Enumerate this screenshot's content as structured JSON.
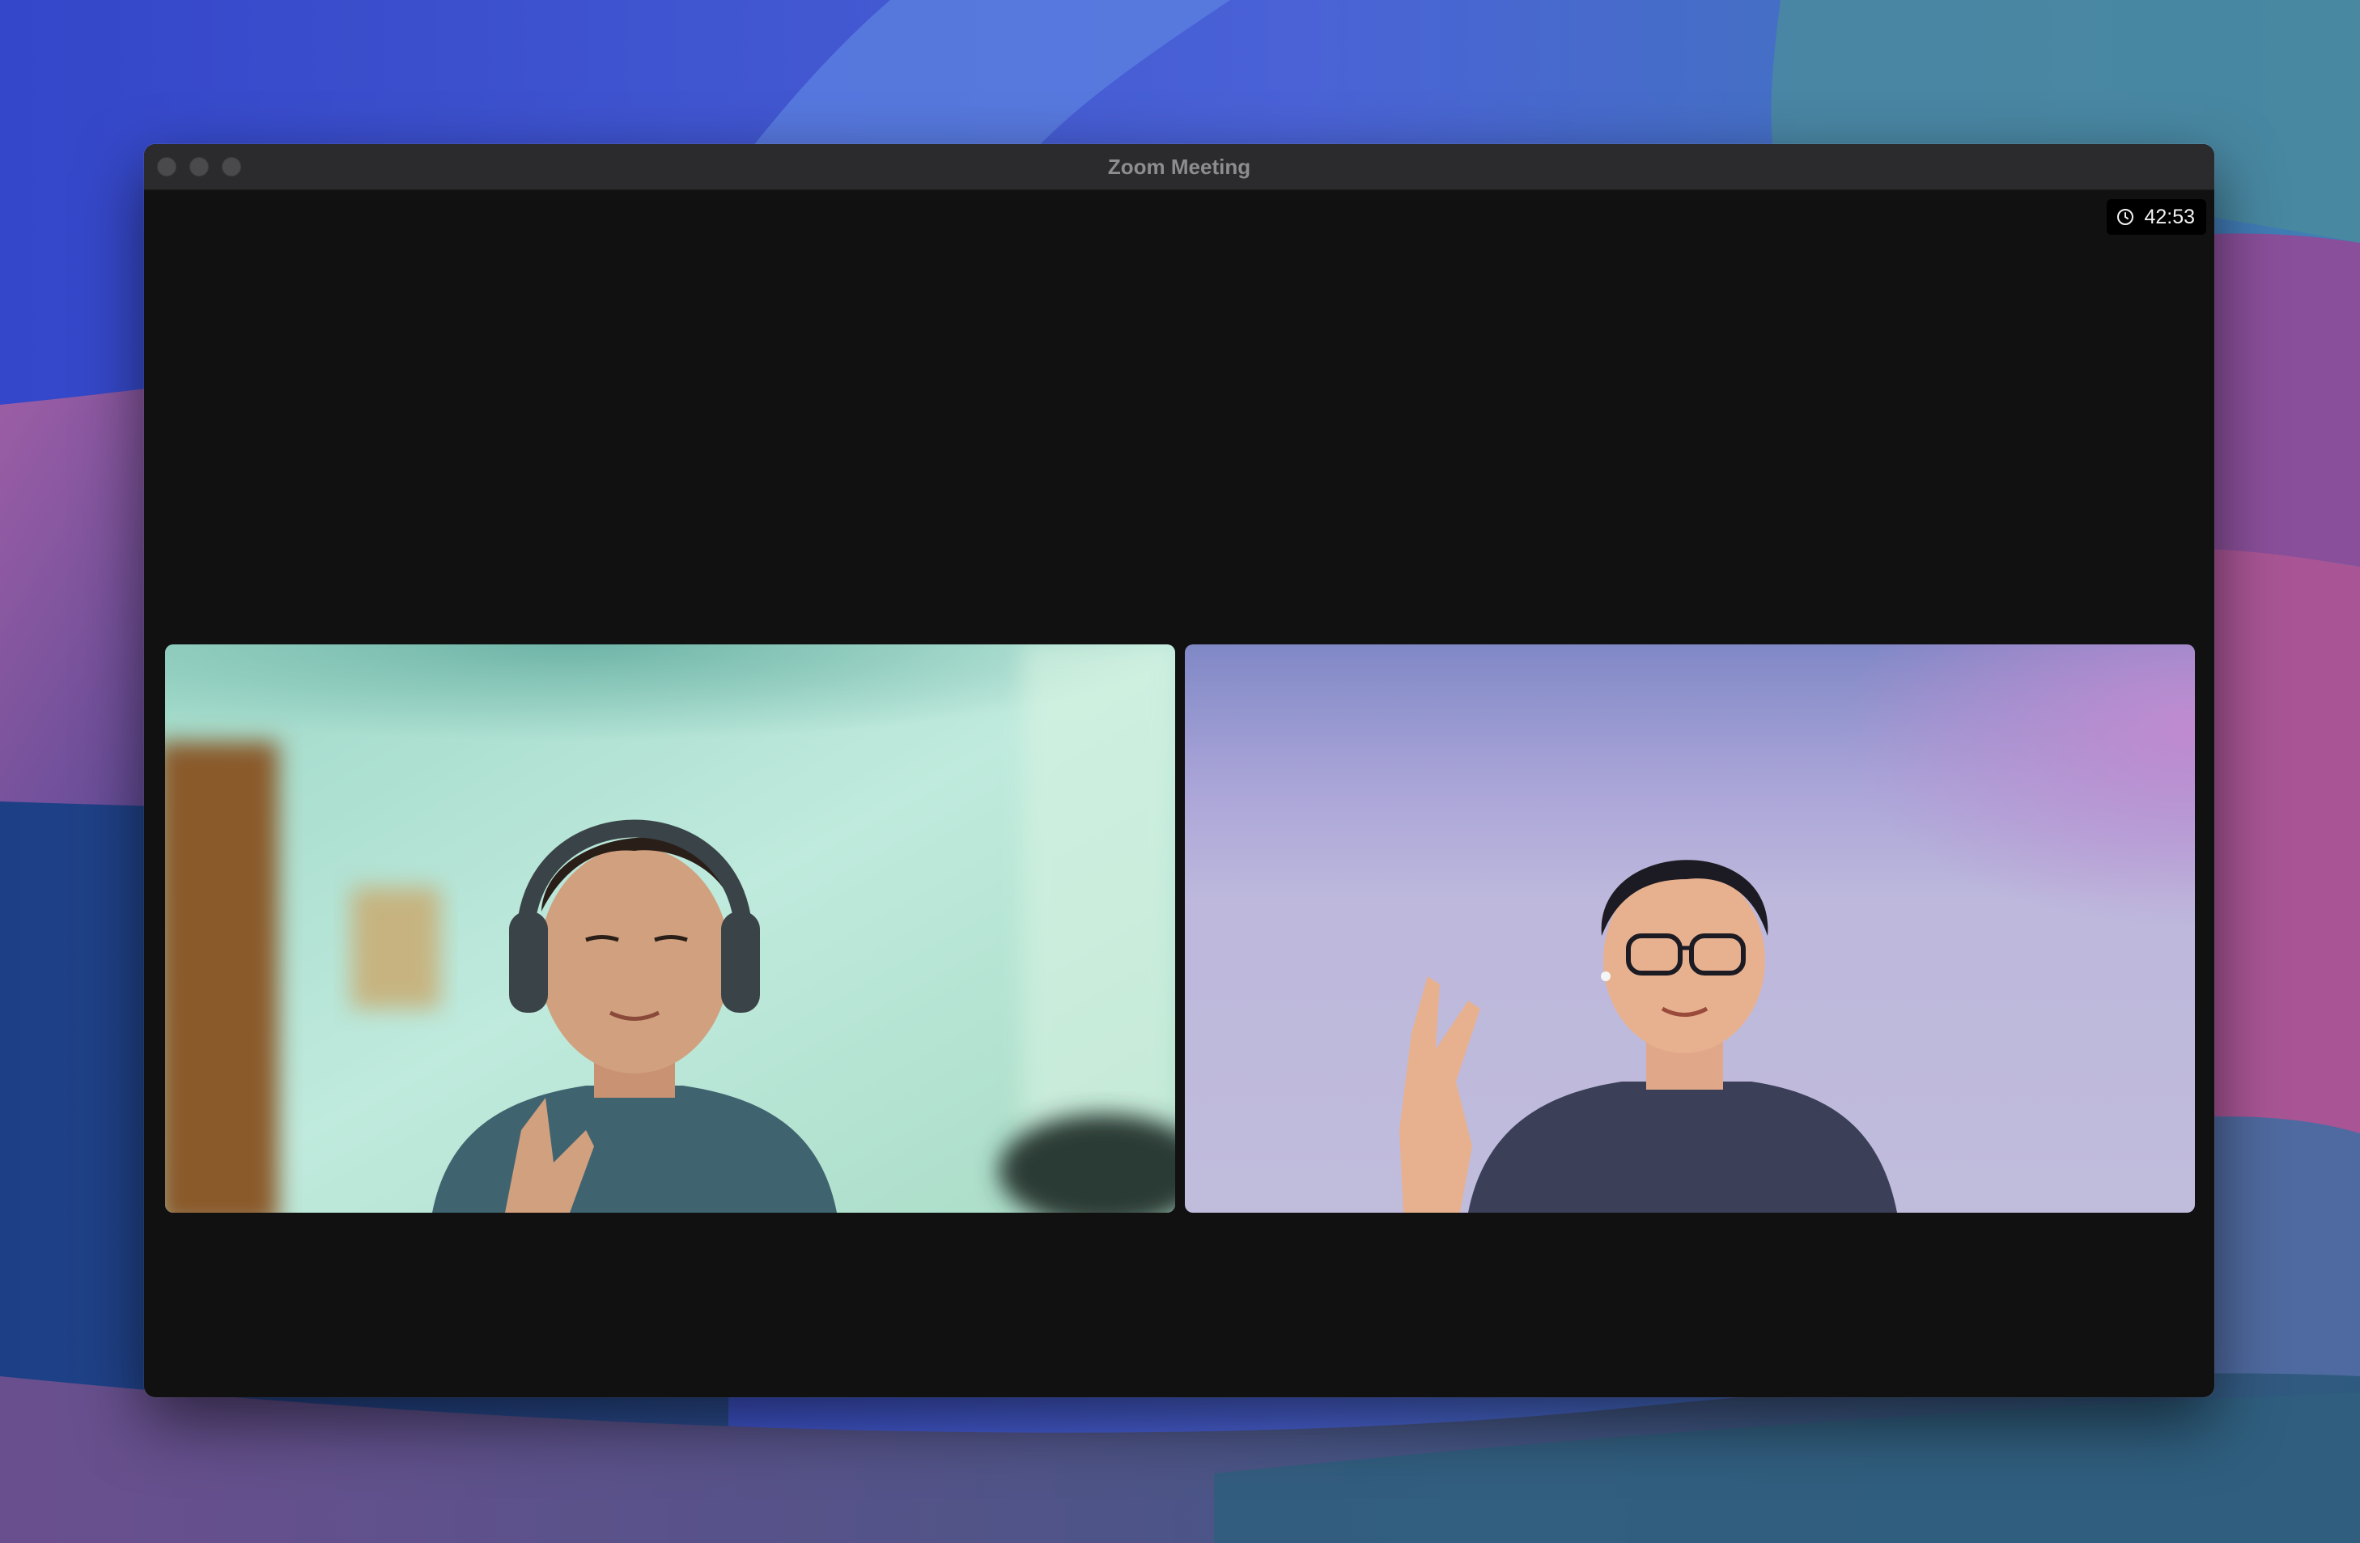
{
  "window": {
    "title": "Zoom Meeting"
  },
  "meeting": {
    "elapsed_time": "42:53",
    "timer_icon": "clock-icon"
  },
  "participants": [
    {
      "tile_background": "#bfeadd",
      "shirt_color": "#3f6470"
    },
    {
      "tile_background": "#bdb8dc",
      "shirt_color": "#3b4058"
    }
  ],
  "colors": {
    "window_background": "#111111",
    "titlebar": "#2b2b2e",
    "title_text": "#8d8d90"
  }
}
